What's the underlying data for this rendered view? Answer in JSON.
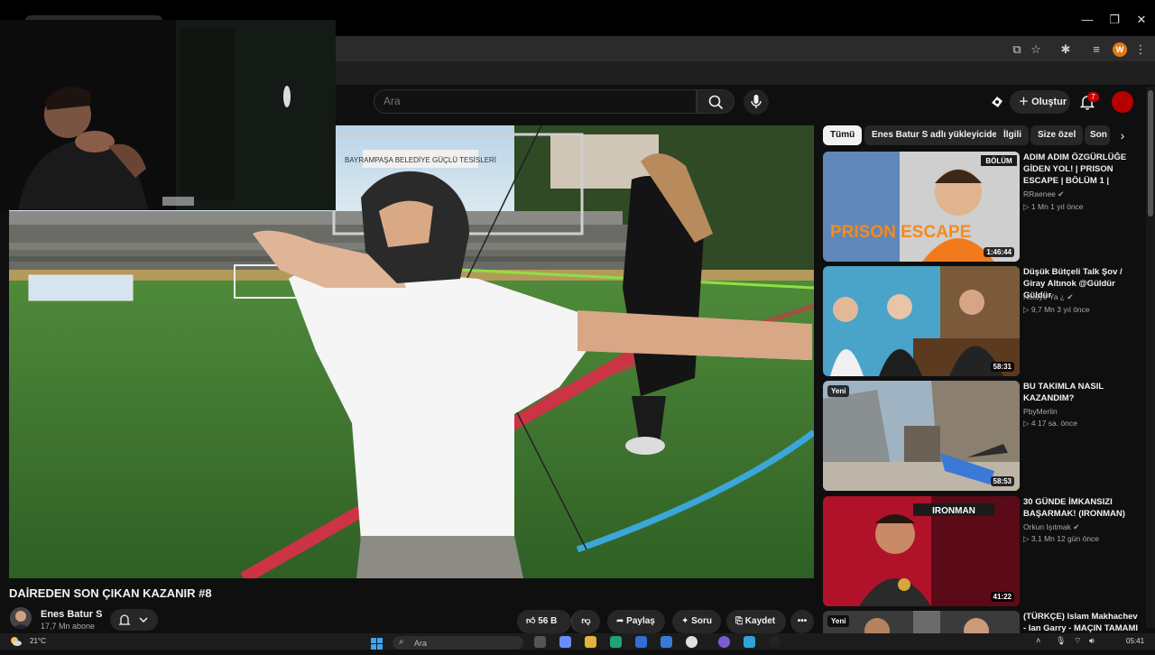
{
  "browser": {
    "profile_initial": "W"
  },
  "yt": {
    "search_placeholder": "Ara",
    "create_label": "Oluştur",
    "notif_count": "7"
  },
  "video": {
    "title": "DAİREDEN SON ÇIKAN KAZANIR #8",
    "channel_name": "Enes Batur S",
    "subscribers": "17,7 Mn abone",
    "likes": "56 B",
    "share_label": "Paylaş",
    "ask_label": "Soru",
    "save_label": "Kaydet"
  },
  "chips": [
    {
      "label": "Tümü"
    },
    {
      "label": "Enes Batur S adlı yükleyiciden"
    },
    {
      "label": "İlgili"
    },
    {
      "label": "Size özel"
    },
    {
      "label": "Son"
    }
  ],
  "suggestions": [
    {
      "title": "ADIM ADIM ÖZGÜRLÜĞE GİDEN YOL! | PRISON ESCAPE | BÖLÜM 1 |",
      "channel": "RRaenee",
      "meta": "▷ 1 Mn   1 yıl önce",
      "duration": "1:46:44",
      "thumb_text": "PRISON ESCAPE",
      "thumb_tag": "BÖLÜM"
    },
    {
      "title": "Düşük Bütçeli Talk Şov / Giray Altınok @Güldür Güldür",
      "channel": "Noluyo Ya ¿",
      "meta": "▷ 9,7 Mn   3 yıl önce",
      "duration": "58:31"
    },
    {
      "title": "BU TAKIMLA NASIL KAZANDIM?",
      "channel": "PbyMerlin",
      "meta": "▷ 4   17 sa. önce",
      "duration": "58:53",
      "badge": "Yeni"
    },
    {
      "title": "30 GÜNDE İMKANSIZI BAŞARMAK! (IRONMAN)",
      "channel": "Orkun Işıtmak",
      "meta": "▷ 3,1 Mn   12 gün önce",
      "duration": "41:22",
      "thumb_text": "IRONMAN"
    },
    {
      "title": "(TÜRKÇE) Islam Makhachev - Ian Garry - MAÇIN TAMAMI",
      "badge": "Yeni"
    }
  ],
  "video_scene": {
    "banner": "BAYRAMPAŞA BELEDİYE GÜÇLÜ TESİSLERİ"
  },
  "taskbar": {
    "temperature": "21°C",
    "search_placeholder": "Ara",
    "time": "05:41"
  },
  "colors": {
    "bg": "#0f0f0f",
    "surface": "#272727",
    "accent": "#cc0000",
    "profile": "#e07b1a"
  }
}
